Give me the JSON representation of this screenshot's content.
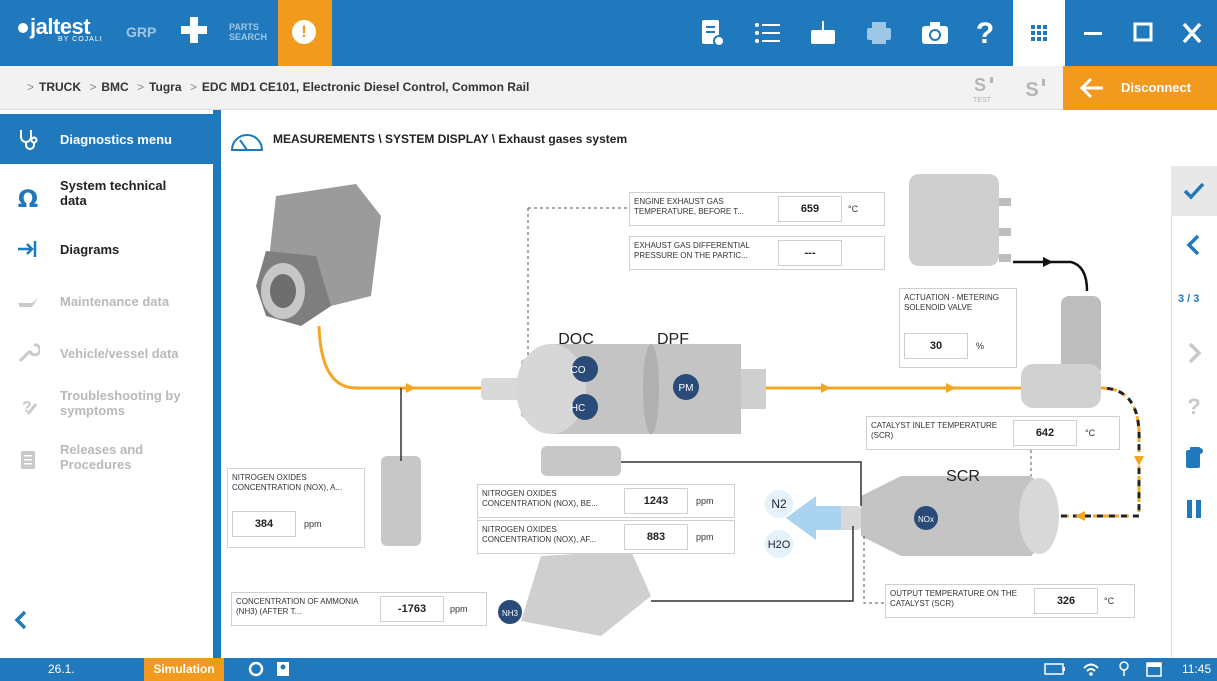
{
  "topbar": {
    "logo": "jaltest",
    "logo_sub": "BY COJALI",
    "grp": "GRP",
    "parts_line1": "PARTS",
    "parts_line2": "SEARCH",
    "alert": "!"
  },
  "breadcrumb": {
    "items": [
      "TRUCK",
      "BMC",
      "Tugra",
      "EDC MD1 CE101, Electronic Diesel Control, Common Rail"
    ],
    "test_label": "TEST",
    "disconnect": "Disconnect"
  },
  "sidebar": {
    "items": [
      {
        "label": "Diagnostics menu",
        "state": "active"
      },
      {
        "label": "System technical data",
        "state": "enabled"
      },
      {
        "label": "Diagrams",
        "state": "enabled"
      },
      {
        "label": "Maintenance data",
        "state": "disabled"
      },
      {
        "label": "Vehicle/vessel data",
        "state": "disabled"
      },
      {
        "label": "Troubleshooting by symptoms",
        "state": "disabled"
      },
      {
        "label": "Releases and Procedures",
        "state": "disabled"
      }
    ]
  },
  "main": {
    "title": "MEASUREMENTS \\ SYSTEM DISPLAY \\ Exhaust gases system",
    "components": {
      "doc": "DOC",
      "dpf": "DPF",
      "scr": "SCR",
      "co": "CO",
      "hc": "HC",
      "pm": "PM",
      "nox": "NOx",
      "nh3": "NH3",
      "n2": "N2",
      "h2o": "H2O"
    },
    "measurements": [
      {
        "label": "ENGINE EXHAUST GAS TEMPERATURE, BEFORE T...",
        "value": "659",
        "unit": "°C"
      },
      {
        "label": "EXHAUST GAS DIFFERENTIAL PRESSURE ON THE PARTIC...",
        "value": "---",
        "unit": ""
      },
      {
        "label": "ACTUATION - METERING SOLENOID VALVE",
        "value": "30",
        "unit": "%"
      },
      {
        "label": "CATALYST INLET TEMPERATURE (SCR)",
        "value": "642",
        "unit": "°C"
      },
      {
        "label": "NITROGEN OXIDES CONCENTRATION (NOX), A...",
        "value": "384",
        "unit": "ppm"
      },
      {
        "label": "NITROGEN OXIDES CONCENTRATION (NOX), BE...",
        "value": "1243",
        "unit": "ppm"
      },
      {
        "label": "NITROGEN OXIDES CONCENTRATION (NOX), AF...",
        "value": "883",
        "unit": "ppm"
      },
      {
        "label": "CONCENTRATION OF AMMONIA (NH3) (AFTER T...",
        "value": "-1763",
        "unit": "ppm"
      },
      {
        "label": "OUTPUT TEMPERATURE ON THE CATALYST (SCR)",
        "value": "326",
        "unit": "°C"
      }
    ]
  },
  "rail": {
    "page": "3 / 3"
  },
  "status": {
    "version": "26.1.",
    "mode": "Simulation",
    "time": "11:45"
  },
  "colors": {
    "primary": "#2079bd",
    "accent": "#f29a1e",
    "flow": "#f5a623"
  }
}
